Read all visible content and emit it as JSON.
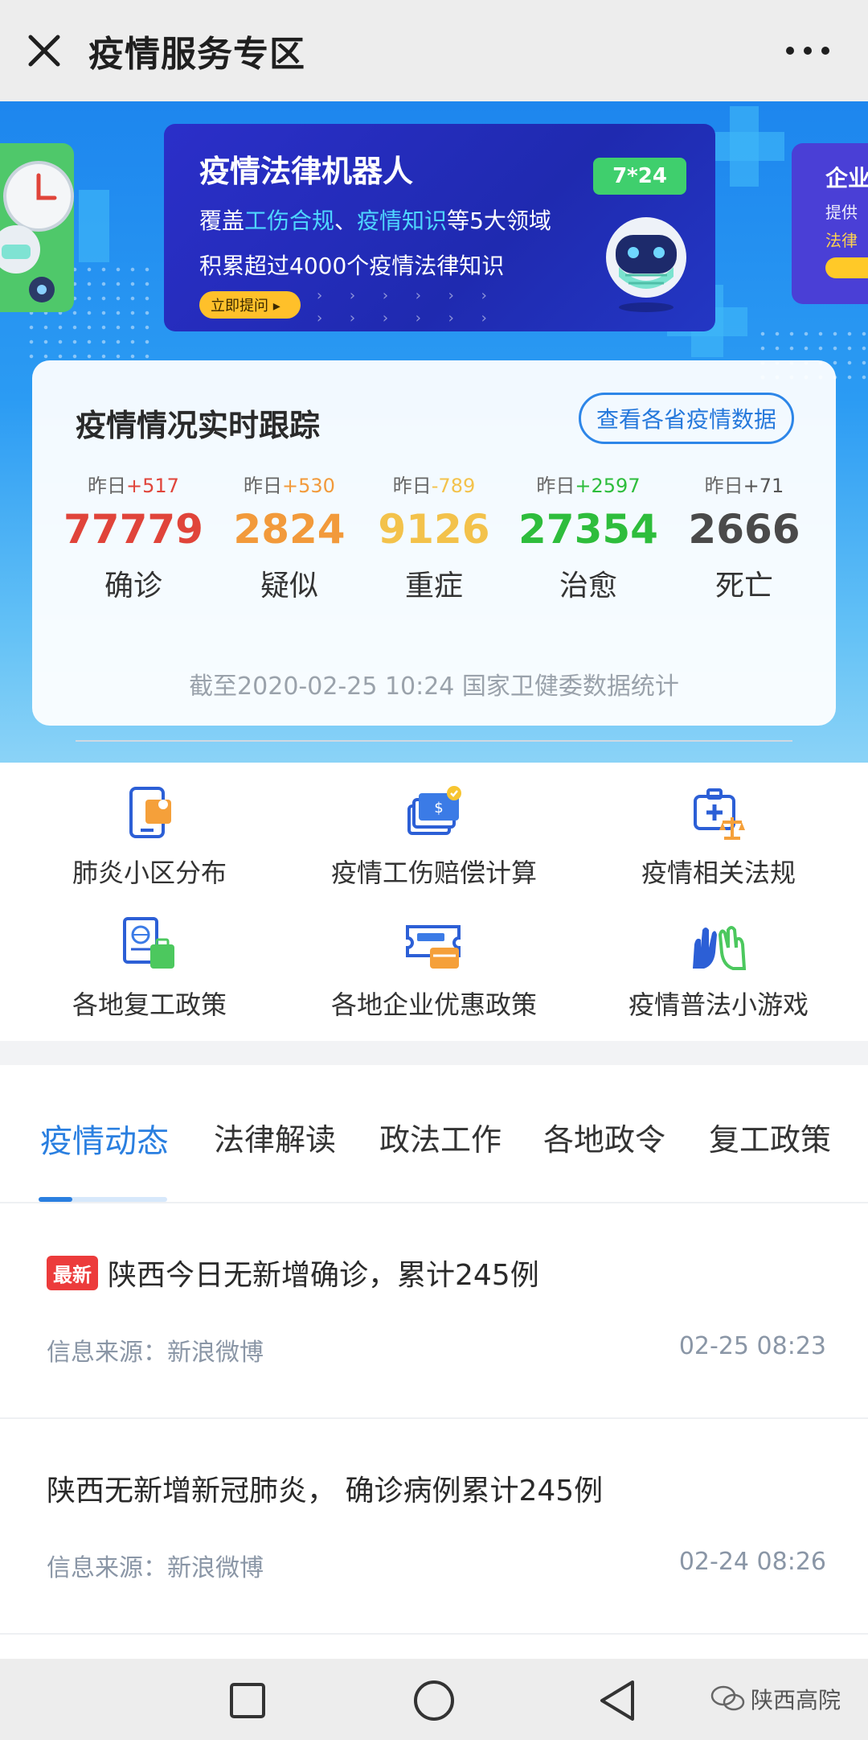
{
  "header": {
    "title": "疫情服务专区"
  },
  "banner": {
    "title": "疫情法律机器人",
    "line1_prefix": "覆盖",
    "line1_hl1": "工伤合规",
    "line1_sep": "、",
    "line1_hl2": "疫情知识",
    "line1_suffix": "等5大领域",
    "line2": "积累超过4000个疫情法律知识",
    "button": "立即提问 ▸",
    "badge": "7*24"
  },
  "side_banner_right": {
    "line1": "企业",
    "line2": "提供",
    "line3": "法律"
  },
  "stats": {
    "title": "疫情情况实时跟踪",
    "link": "查看各省疫情数据",
    "items": [
      {
        "yday_label": "昨日",
        "yday": "+517",
        "value": "77779",
        "label": "确诊",
        "color": "#e0443a"
      },
      {
        "yday_label": "昨日",
        "yday": "+530",
        "value": "2824",
        "label": "疑似",
        "color": "#f29a3b"
      },
      {
        "yday_label": "昨日",
        "yday": "-789",
        "value": "9126",
        "label": "重症",
        "color": "#f3c24b"
      },
      {
        "yday_label": "昨日",
        "yday": "+2597",
        "value": "27354",
        "label": "治愈",
        "color": "#2ebd3c"
      },
      {
        "yday_label": "昨日",
        "yday": "+71",
        "value": "2666",
        "label": "死亡",
        "color": "#4a4a4a"
      }
    ],
    "note": "截至2020-02-25 10:24 国家卫健委数据统计"
  },
  "services": [
    {
      "label": "肺炎小区分布",
      "icon": "map-pin-phone-icon"
    },
    {
      "label": "疫情工伤赔偿计算",
      "icon": "money-stack-icon"
    },
    {
      "label": "疫情相关法规",
      "icon": "medical-law-icon"
    },
    {
      "label": "各地复工政策",
      "icon": "passport-suitcase-icon"
    },
    {
      "label": "各地企业优惠政策",
      "icon": "ticket-card-icon"
    },
    {
      "label": "疫情普法小游戏",
      "icon": "hands-game-icon"
    }
  ],
  "tabs": [
    {
      "label": "疫情动态",
      "active": true
    },
    {
      "label": "法律解读",
      "active": false
    },
    {
      "label": "政法工作",
      "active": false
    },
    {
      "label": "各地政令",
      "active": false
    },
    {
      "label": "复工政策",
      "active": false
    }
  ],
  "news": [
    {
      "tag": "最新",
      "title": "陕西今日无新增确诊，累计245例",
      "source": "信息来源：新浪微博",
      "time": "02-25 08:23"
    },
    {
      "tag": "",
      "title": "陕西无新增新冠肺炎， 确诊病例累计245例",
      "source": "信息来源：新浪微博",
      "time": "02-24 08:26"
    }
  ],
  "watermark": "陕西高院",
  "colors": {
    "accent": "#2a7fe0",
    "banner": "#2430c0",
    "tag_new": "#ec3b3b"
  }
}
